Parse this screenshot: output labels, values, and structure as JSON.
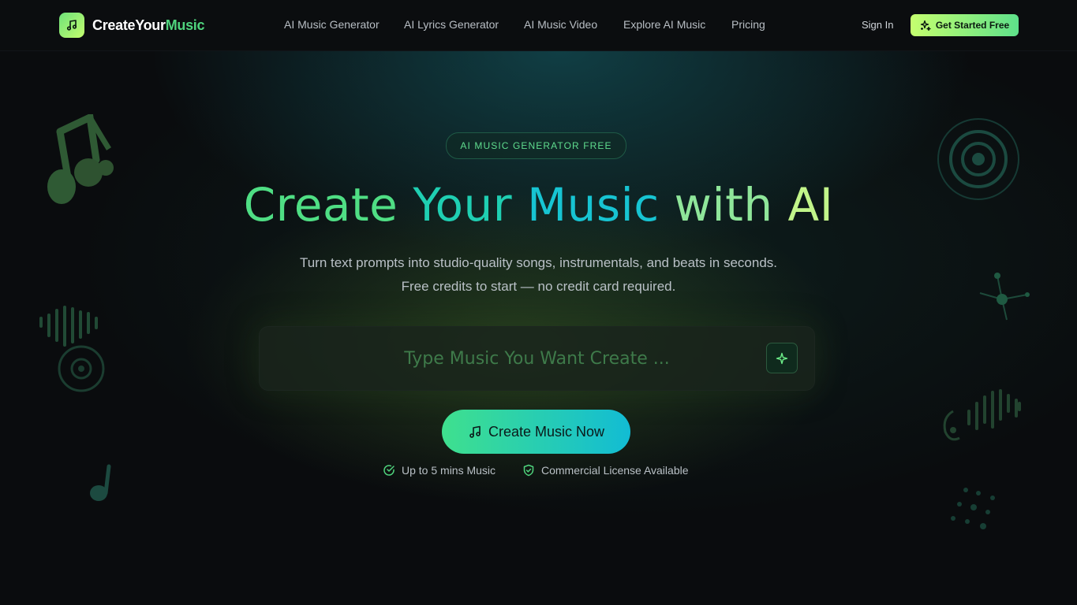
{
  "brand": {
    "name_part1": "CreateYour",
    "name_part2": "Music"
  },
  "nav": {
    "links": [
      "AI Music Generator",
      "AI Lyrics Generator",
      "AI Music Video",
      "Explore AI Music",
      "Pricing"
    ],
    "sign_in": "Sign In",
    "cta": "Get Started Free"
  },
  "hero": {
    "badge": "AI MUSIC GENERATOR FREE",
    "title_words": [
      "Create",
      "Your",
      "Music",
      "with",
      "AI"
    ],
    "subtitle_line1": "Turn text prompts into studio-quality songs, instrumentals, and beats in seconds.",
    "subtitle_line2": "Free credits to start — no credit card required.",
    "prompt_placeholder": "Type Music You Want Create ...",
    "create_button": "Create Music Now",
    "features": [
      "Up to 5 mins Music",
      "Commercial License Available"
    ]
  },
  "colors": {
    "accent_green": "#4fd47d",
    "accent_lime": "#c5ff6f",
    "accent_cyan": "#12bcd4",
    "background": "#0a0c0e"
  },
  "icons": {
    "logo": "music-note-icon",
    "cta": "sparkles-icon",
    "prompt": "sparkle-icon",
    "create": "music-note-icon",
    "feature1": "check-circle-icon",
    "feature2": "shield-check-icon"
  }
}
